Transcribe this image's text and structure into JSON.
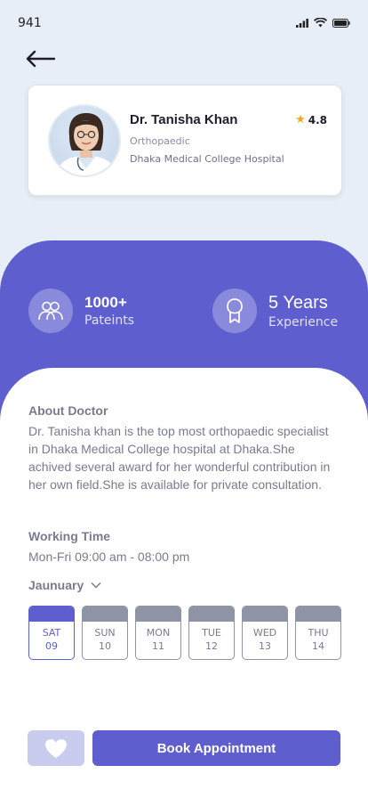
{
  "status_bar": {
    "time": "941"
  },
  "doctor": {
    "name": "Dr. Tanisha Khan",
    "rating": "4.8",
    "specialty": "Orthopaedic",
    "hospital": "Dhaka Medical College Hospital"
  },
  "stats": {
    "patients": {
      "value": "1000+",
      "label": "Pateints",
      "icon": "people-icon"
    },
    "experience": {
      "value": "5 Years",
      "label": "Experience",
      "icon": "award-icon"
    }
  },
  "about": {
    "title": "About Doctor",
    "text": "Dr. Tanisha khan is the top most orthopaedic specialist in Dhaka Medical College hospital at Dhaka.She achived several award for her wonderful contribution in her own field.She is available for private consultation."
  },
  "working": {
    "title": "Working Time",
    "hours": "Mon-Fri 09:00 am - 08:00 pm"
  },
  "calendar": {
    "month": "Jaunuary",
    "days": [
      {
        "name": "SAT",
        "num": "09",
        "selected": true
      },
      {
        "name": "SUN",
        "num": "10",
        "selected": false
      },
      {
        "name": "MON",
        "num": "11",
        "selected": false
      },
      {
        "name": "TUE",
        "num": "12",
        "selected": false
      },
      {
        "name": "WED",
        "num": "13",
        "selected": false
      },
      {
        "name": "THU",
        "num": "14",
        "selected": false
      }
    ]
  },
  "actions": {
    "book_label": "Book Appointment"
  },
  "colors": {
    "primary": "#5e5ecf",
    "background": "#e8eef7",
    "star": "#f5a623"
  }
}
